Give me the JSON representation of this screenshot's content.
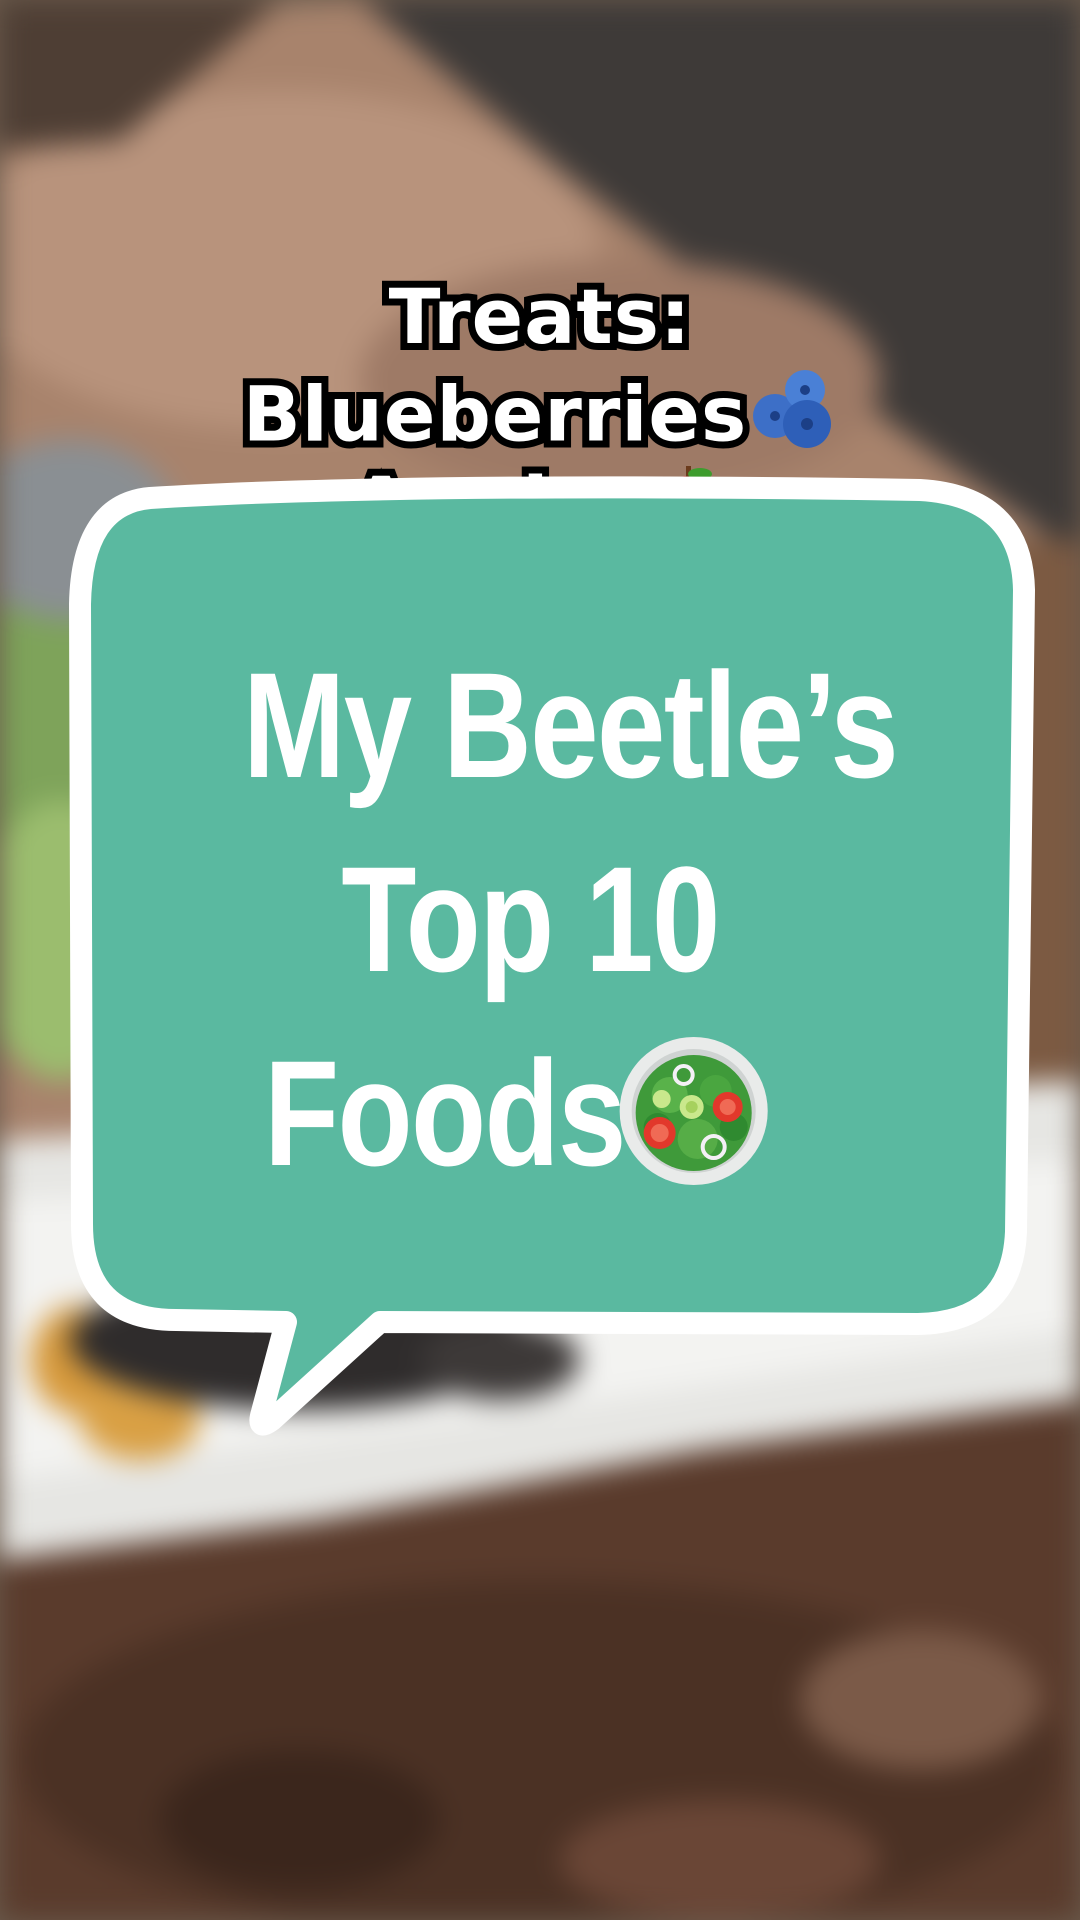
{
  "caption": {
    "line1": "Treats:",
    "line2": "Blueberries",
    "line3": "Apples",
    "line2_emoji": "blueberries-icon",
    "line3_emoji": "apple-icon"
  },
  "bubble": {
    "title_line1": "My Beetle’s",
    "title_line2": "Top 10",
    "title_line3": "Foods",
    "title_emoji": "salad-icon",
    "fill_color": "#5ab9a0",
    "border_color": "#ffffff"
  }
}
